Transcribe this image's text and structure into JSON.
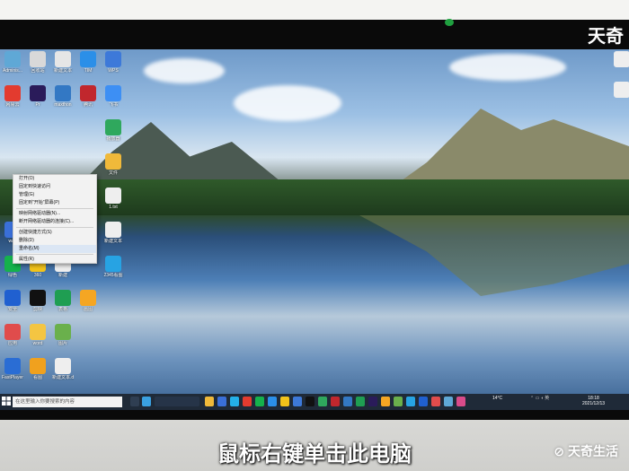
{
  "logos": {
    "top": "天奇",
    "bottom": "天奇生活"
  },
  "caption": "鼠标右键单击此电脑",
  "desktop": {
    "icons": [
      {
        "label": "Adminis...",
        "color": "#5fa8d6"
      },
      {
        "label": "回收站",
        "color": "#d9d9d9"
      },
      {
        "label": "新建文本",
        "color": "#e6e6e6"
      },
      {
        "label": "TIM",
        "color": "#2b8fe8"
      },
      {
        "label": "WPS",
        "color": "#3d79d9"
      },
      {
        "label": "网易云",
        "color": "#e33b2f"
      },
      {
        "label": "Pr",
        "color": "#2a1b5a"
      },
      {
        "label": "maxthon",
        "color": "#3378c4"
      },
      {
        "label": "腾讯",
        "color": "#c1272d"
      },
      {
        "label": "飞书",
        "color": "#3d8ff4"
      },
      {
        "label": "播放器",
        "color": "#2fa85d"
      },
      {
        "label": "文件",
        "color": "#f0b93a"
      },
      {
        "label": "1.txt",
        "color": "#eeeeee"
      },
      {
        "label": "新建文本",
        "color": "#eeeeee"
      },
      {
        "label": "wav",
        "color": "#3a6fd8"
      },
      {
        "label": "抖音",
        "color": "#111111"
      },
      {
        "label": "风云视频",
        "color": "#2a90e0"
      },
      {
        "label": "2345看图",
        "color": "#27a3e3"
      },
      {
        "label": "绿色",
        "color": "#15b24c"
      },
      {
        "label": "360",
        "color": "#f2c31a"
      },
      {
        "label": "新建",
        "color": "#eeeeee"
      },
      {
        "label": "安全",
        "color": "#2060d0"
      },
      {
        "label": "剪映",
        "color": "#111111"
      },
      {
        "label": "表格",
        "color": "#1f9e52"
      },
      {
        "label": "画图",
        "color": "#f5a623"
      },
      {
        "label": "应用",
        "color": "#e04c4c"
      },
      {
        "label": "word",
        "color": "#f4c542"
      },
      {
        "label": "图片",
        "color": "#6ab04c"
      },
      {
        "label": "FastPlayer 64bit",
        "color": "#2a6dd4"
      },
      {
        "label": "看图",
        "color": "#f0a11e"
      },
      {
        "label": "新建文本.docx",
        "color": "#eeeeee"
      }
    ]
  },
  "context_menu": {
    "items": [
      {
        "label": "打开(O)"
      },
      {
        "label": "固定到快速访问"
      },
      {
        "label": "管理(G)"
      },
      {
        "label": "固定到\"开始\"屏幕(P)"
      },
      {
        "label": "映射网络驱动器(N)..."
      },
      {
        "label": "断开网络驱动器的连接(C)..."
      },
      {
        "label": "创建快捷方式(S)"
      },
      {
        "label": "删除(D)"
      },
      {
        "label": "重命名(M)"
      },
      {
        "label": "属性(R)"
      }
    ]
  },
  "taskbar": {
    "search_placeholder": "在这里输入你要搜索的内容",
    "temperature": "14°C",
    "time": "18:18",
    "date": "2021/12/13"
  }
}
